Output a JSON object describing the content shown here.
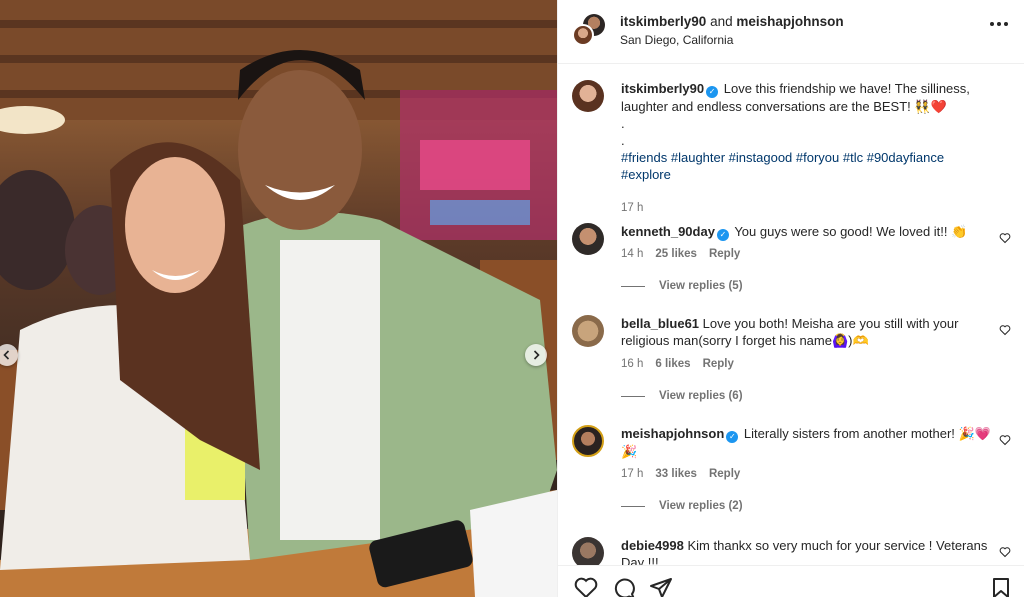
{
  "post": {
    "owner_1": "itskimberly90",
    "and_text": "and",
    "owner_2": "meishapjohnson",
    "location": "San Diego, California"
  },
  "caption": {
    "user": "itskimberly90",
    "text": "Love this friendship we have! The silliness, laughter and endless conversations are the BEST! 👯❤️",
    "dot1": ".",
    "dot2": ".",
    "hashtags": "#friends #laughter #instagood #foryou #tlc #90dayfiance #explore",
    "time": "17 h"
  },
  "comments": [
    {
      "user": "kenneth_90day",
      "verified": true,
      "text": "You guys were so good! We loved it!! 👏",
      "time": "14 h",
      "likes": "25 likes",
      "reply": "Reply",
      "view_replies": "View replies (5)"
    },
    {
      "user": "bella_blue61",
      "verified": false,
      "text": "Love you both! Meisha are you still with your religious man(sorry I forget his name🙆‍♀️)🫶",
      "time": "16 h",
      "likes": "6 likes",
      "reply": "Reply",
      "view_replies": "View replies (6)"
    },
    {
      "user": "meishapjohnson",
      "verified": true,
      "text": "Literally sisters from another mother! 🎉💗🎉",
      "time": "17 h",
      "likes": "33 likes",
      "reply": "Reply",
      "view_replies": "View replies (2)"
    },
    {
      "user": "debie4998",
      "verified": false,
      "text": "Kim thankx so very much for your service ! Veterans Day !!!"
    }
  ],
  "icons": {
    "more": "more-options-icon",
    "like": "heart-icon",
    "comment": "comment-icon",
    "share": "share-icon",
    "save": "bookmark-icon",
    "prev": "chevron-left-icon",
    "next": "chevron-right-icon"
  },
  "colors": {
    "verified": "#1c96f0",
    "hashtag": "#00376b",
    "muted": "#737373"
  }
}
